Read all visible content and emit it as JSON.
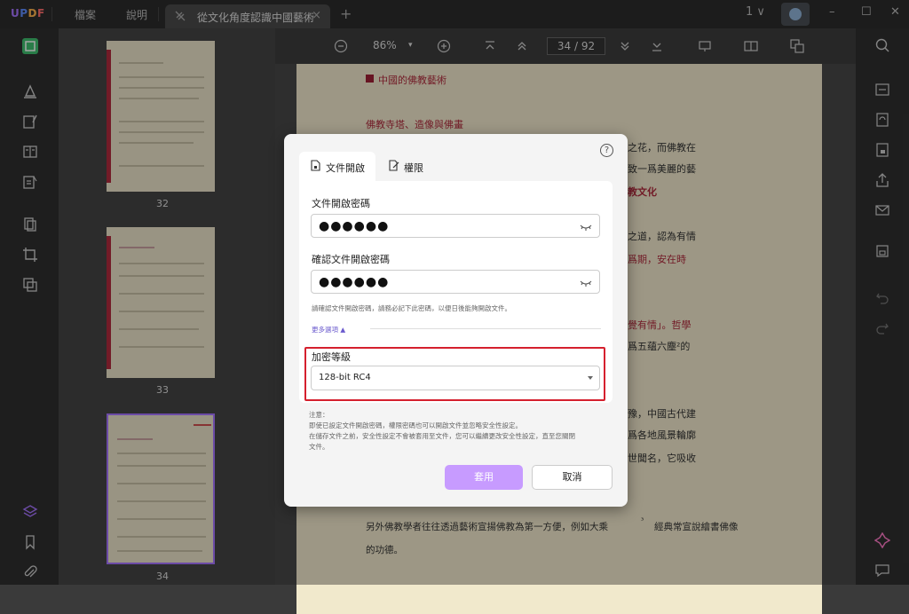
{
  "app": {
    "logo": {
      "u": "U",
      "p": "P",
      "d": "D",
      "f": "F"
    },
    "menu": {
      "file": "檔案",
      "help": "說明"
    },
    "tab_title": "從文化角度認識中國藝術",
    "tab_close": "×",
    "new_tab": "+",
    "window_count": "1 ∨",
    "minimize": "–",
    "maximize": "☐",
    "close": "✕"
  },
  "thumbnails": [
    {
      "page": "32"
    },
    {
      "page": "33"
    },
    {
      "page": "34"
    }
  ],
  "doc_toolbar": {
    "zoom": "86%",
    "zoom_caret": "▾",
    "page_indicator": "34 / 92"
  },
  "page_text": {
    "section": "中國的佛教藝術",
    "heading": "佛教寺塔、造像與佛畫",
    "r1": "之花，而佛教在",
    "r2": "致一爲美麗的藝",
    "r3": "教文化",
    "r4": "之道，認為有情",
    "r5": "爲期，安在時",
    "r6": "覺有情」。哲學",
    "r7": "爲五蘊六塵²的",
    "r8": "豫，中國古代建",
    "r9": "爲各地風景輪廓",
    "r10": "世聞名，它吸收",
    "b1": "另外佛教學者往往透過藝術宣揚佛教為第一方便，例如大乘",
    "b1_tail": "經典常宣說繪書佛像",
    "b1_sup": "³",
    "b2": "的功德。"
  },
  "dialog": {
    "help": "?",
    "tabs": {
      "open": "文件開啟",
      "permissions": "權限"
    },
    "open_pwd_label": "文件開啟密碼",
    "open_pwd_value": "●●●●●●",
    "confirm_pwd_label": "確認文件開啟密碼",
    "confirm_pwd_value": "●●●●●●",
    "hint": "請確認文件開啟密碼，請務必記下此密碼，以便日後能夠開啟文件。",
    "more_options": "更多選項 ▲",
    "encryption_label": "加密等級",
    "encryption_value": "128-bit RC4",
    "note_title": "注意：",
    "note_1": "即使已設定文件開啟密碼，權限密碼也可以開啟文件並忽略安全性設定。",
    "note_2": "在儲存文件之前，安全性設定不會被套用至文件，您可以繼續更改安全性設定，直至您關閉",
    "note_3": "文件。",
    "apply": "套用",
    "cancel": "取消"
  }
}
